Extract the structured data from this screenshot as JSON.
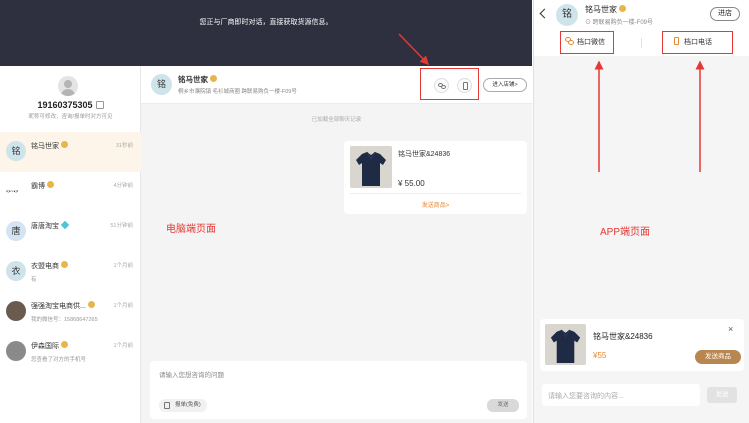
{
  "pc": {
    "top_notice": "您正与厂商即时对话，直接获取货源信息。",
    "me": {
      "phone": "19160375305",
      "subtitle": "昵称可修改，咨询/报单时对方可见"
    },
    "conversations": [
      {
        "avatar_text": "铭",
        "name": "铭马世家",
        "time": "31秒前",
        "message": "",
        "badge": "gold",
        "active": true
      },
      {
        "avatar_text": "",
        "name": "霸博",
        "time": "4分钟前",
        "message": "",
        "badge": "gold",
        "active": false
      },
      {
        "avatar_text": "唐",
        "name": "唐唐淘宝",
        "time": "51分钟前",
        "message": "",
        "badge": "diamond",
        "active": false
      },
      {
        "avatar_text": "衣",
        "name": "衣盟电商",
        "time": "1个月前",
        "message": "有",
        "badge": "gold",
        "active": false
      },
      {
        "avatar_text": "",
        "name": "强强淘宝电商供...",
        "time": "1个月前",
        "message": "我的微信号：15868647265",
        "badge": "gold",
        "active": false
      },
      {
        "avatar_text": "",
        "name": "伊森国际",
        "time": "1个月前",
        "message": "您查看了对方的手机号",
        "badge": "gold",
        "active": false
      }
    ],
    "chat": {
      "avatar_text": "铭",
      "name": "铭马世家",
      "address": "桐乡市濮院镇 毛衫城商圈 跨联易购负一楼-F09号",
      "enter_store": "进入店铺>",
      "loaded_text": "已加载全部聊天记录",
      "product": {
        "title": "铭马世家&24836",
        "price": "¥ 55.00",
        "send_label": "发送商品>"
      },
      "input_placeholder": "请输入您想咨询的问题",
      "quote_label": "报单(免费)",
      "send_label": "发送"
    },
    "label": "电脑端页面"
  },
  "app": {
    "avatar_text": "铭",
    "name": "铭马世家",
    "address": "跨联易购负一楼-F09号",
    "store_button": "进店",
    "wechat_button": "档口微信",
    "phone_button": "档口电话",
    "label": "APP端页面",
    "product": {
      "title": "铭马世家&24836",
      "price": "¥55",
      "send_label": "发送商品",
      "close_icon": "×"
    },
    "input_placeholder": "请输入您要咨询的内容...",
    "send_label": "发送"
  },
  "colors": {
    "accent_red": "#e53935",
    "gold": "#e7b64a",
    "orange": "#e8892f",
    "send_brown": "#b8864f",
    "dark_header": "#2e3040"
  }
}
